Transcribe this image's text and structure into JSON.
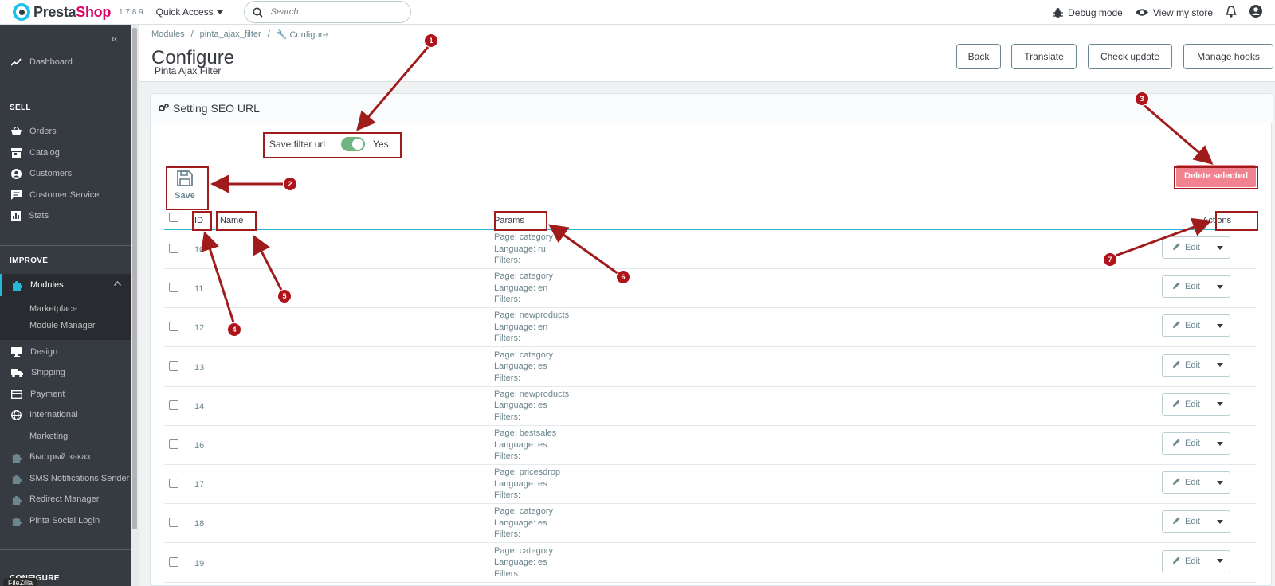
{
  "header": {
    "logo_presta": "Presta",
    "logo_shop": "Shop",
    "version": "1.7.8.9",
    "quick_access": "Quick Access",
    "search_placeholder": "Search",
    "debug_mode": "Debug mode",
    "view_store": "View my store"
  },
  "sidebar": {
    "dashboard": "Dashboard",
    "sections": {
      "sell": "SELL",
      "improve": "IMPROVE",
      "configure": "CONFIGURE"
    },
    "sell_items": [
      "Orders",
      "Catalog",
      "Customers",
      "Customer Service",
      "Stats"
    ],
    "improve_items": {
      "modules": "Modules",
      "modules_sub": [
        "Marketplace",
        "Module Manager"
      ],
      "others": [
        "Design",
        "Shipping",
        "Payment",
        "International",
        "Marketing",
        "Быстрый заказ",
        "SMS Notifications Sender",
        "Redirect Manager",
        "Pinta Social Login"
      ]
    },
    "taskbar_label": "FileZilla"
  },
  "page": {
    "breadcrumb": [
      "Modules",
      "pinta_ajax_filter",
      "Configure"
    ],
    "title": "Configure",
    "subtitle": "Pinta Ajax Filter",
    "buttons": {
      "back": "Back",
      "translate": "Translate",
      "check_update": "Check update",
      "manage_hooks": "Manage hooks"
    }
  },
  "panel": {
    "title": "Setting SEO URL",
    "switch_label": "Save filter url",
    "switch_value": "Yes",
    "switch_on": true,
    "save_label": "Save",
    "delete_selected": "Delete selected",
    "columns": {
      "id": "ID",
      "name": "Name",
      "params": "Params",
      "actions": "Actions"
    },
    "edit_label": "Edit",
    "rows": [
      {
        "id": "10",
        "page": "Page: category",
        "language": "Language: ru",
        "filters": "Filters:"
      },
      {
        "id": "11",
        "page": "Page: category",
        "language": "Language: en",
        "filters": "Filters:"
      },
      {
        "id": "12",
        "page": "Page: newproducts",
        "language": "Language: en",
        "filters": "Filters:"
      },
      {
        "id": "13",
        "page": "Page: category",
        "language": "Language: es",
        "filters": "Filters:"
      },
      {
        "id": "14",
        "page": "Page: newproducts",
        "language": "Language: es",
        "filters": "Filters:"
      },
      {
        "id": "16",
        "page": "Page: bestsales",
        "language": "Language: es",
        "filters": "Filters:"
      },
      {
        "id": "17",
        "page": "Page: pricesdrop",
        "language": "Language: es",
        "filters": "Filters:"
      },
      {
        "id": "18",
        "page": "Page: category",
        "language": "Language: es",
        "filters": "Filters:"
      },
      {
        "id": "19",
        "page": "Page: category",
        "language": "Language: es",
        "filters": "Filters:"
      }
    ]
  },
  "annotations": [
    "1",
    "2",
    "3",
    "4",
    "5",
    "6",
    "7"
  ],
  "colors": {
    "accent": "#25b9d7",
    "brand_pink": "#df0067",
    "sidebar_bg": "#363a41",
    "switch_on": "#70b580",
    "delete_bg": "#f0838f",
    "annotation": "#a01c1c"
  }
}
